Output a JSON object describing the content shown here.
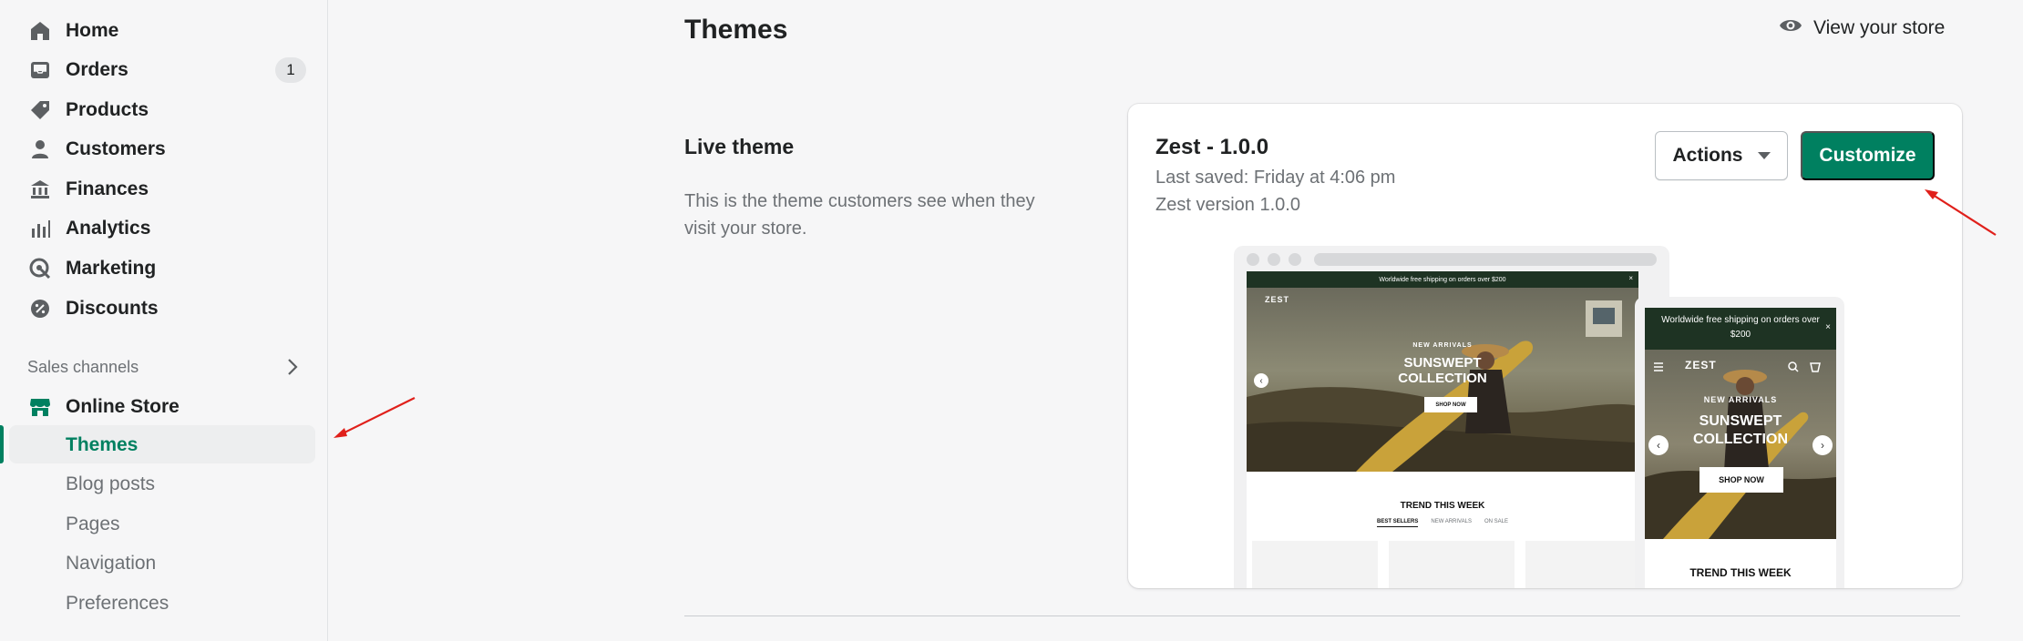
{
  "sidebar": {
    "items": [
      {
        "label": "Home",
        "icon": "home-icon"
      },
      {
        "label": "Orders",
        "icon": "inbox-icon",
        "badge": "1"
      },
      {
        "label": "Products",
        "icon": "tag-icon"
      },
      {
        "label": "Customers",
        "icon": "person-icon"
      },
      {
        "label": "Finances",
        "icon": "bank-icon"
      },
      {
        "label": "Analytics",
        "icon": "bar-chart-icon"
      },
      {
        "label": "Marketing",
        "icon": "target-icon"
      },
      {
        "label": "Discounts",
        "icon": "discount-icon"
      }
    ],
    "sales_channels_label": "Sales channels",
    "online_store_label": "Online Store",
    "subitems": [
      "Themes",
      "Blog posts",
      "Pages",
      "Navigation",
      "Preferences"
    ],
    "active_subitem": "Themes"
  },
  "header": {
    "title": "Themes",
    "view_store_label": "View your store"
  },
  "live_theme": {
    "title": "Live theme",
    "description": "This is the theme customers see when they visit your store."
  },
  "theme_card": {
    "name": "Zest - 1.0.0",
    "last_saved": "Last saved: Friday at 4:06 pm",
    "version": "Zest version 1.0.0",
    "actions_label": "Actions",
    "customize_label": "Customize"
  },
  "preview": {
    "announcement": "Worldwide free shipping on orders over $200",
    "logo": "ZEST",
    "new_arrivals": "NEW ARRIVALS",
    "headline_1": "SUNSWEPT",
    "headline_2": "COLLECTION",
    "shop_now": "SHOP NOW",
    "trend": "TREND THIS WEEK",
    "tabs": [
      "BEST SELLERS",
      "NEW ARRIVALS",
      "ON SALE"
    ],
    "close_glyph": "×",
    "prev_glyph": "‹",
    "next_glyph": "›"
  },
  "colors": {
    "accent": "#008060",
    "annotation_arrow": "#e0201b",
    "preview_dark": "#1e3323"
  }
}
